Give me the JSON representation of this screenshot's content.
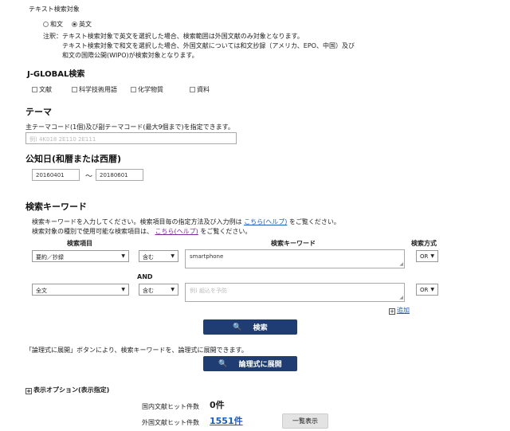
{
  "text_target": {
    "label": "テキスト検索対象",
    "options": [
      "和文",
      "英文"
    ],
    "note_line1": "注釈：テキスト検索対象で英文を選択した場合、検索範囲は外国文献のみ対象となります。",
    "note_line2": "テキスト検索対象で和文を選択した場合、外国文献については和文抄録（アメリカ、EPO、中国）及び",
    "note_line3": "和文の国際公開(WIPO)が検索対象となります。"
  },
  "jglobal": {
    "title": "J-GLOBAL検索",
    "items": [
      "文献",
      "科学技術用語",
      "化学物質",
      "資料"
    ]
  },
  "theme": {
    "title": "テーマ",
    "desc": "主テーマコード(1個)及び副テーマコード(最大9個まで)を指定できます。",
    "placeholder": "例) 4K018 2E110 2E111"
  },
  "pubdate": {
    "title": "公知日(和暦または西暦)",
    "from": "20160401",
    "sep": "～",
    "to": "20180601"
  },
  "keyword": {
    "title": "検索キーワード",
    "line1_pre": "検索キーワードを入力してください。検索項目毎の指定方法及び入力例は",
    "line1_link": "こちら(ヘルプ)",
    "line1_post": "をご覧ください。",
    "line2_pre": "検索対象の種別で使用可能な検索項目は、",
    "line2_link": "こちら(ヘルプ)",
    "line2_post": "をご覧ください。",
    "col_item": "検索項目",
    "col_keyword": "検索キーワード",
    "col_method": "検索方式",
    "rows": [
      {
        "item": "要約／抄録",
        "cond": "含む",
        "keyword": "smartphone",
        "method": "OR"
      },
      {
        "item": "全文",
        "cond": "含む",
        "placeholder": "例) 組込を予防",
        "method": "OR"
      }
    ],
    "and_label": "AND",
    "add_label": "追加"
  },
  "search_button": "検索",
  "expand_note": "「論理式に展開」ボタンにより、検索キーワードを、論理式に展開できます。",
  "expand_button": "論理式に展開",
  "display_options": "表示オプション(表示指定)",
  "hits": {
    "domestic_label": "国内文献ヒット件数",
    "domestic_value": "0件",
    "foreign_label": "外国文献ヒット件数",
    "foreign_value": "1551件",
    "list_button": "一覧表示"
  }
}
